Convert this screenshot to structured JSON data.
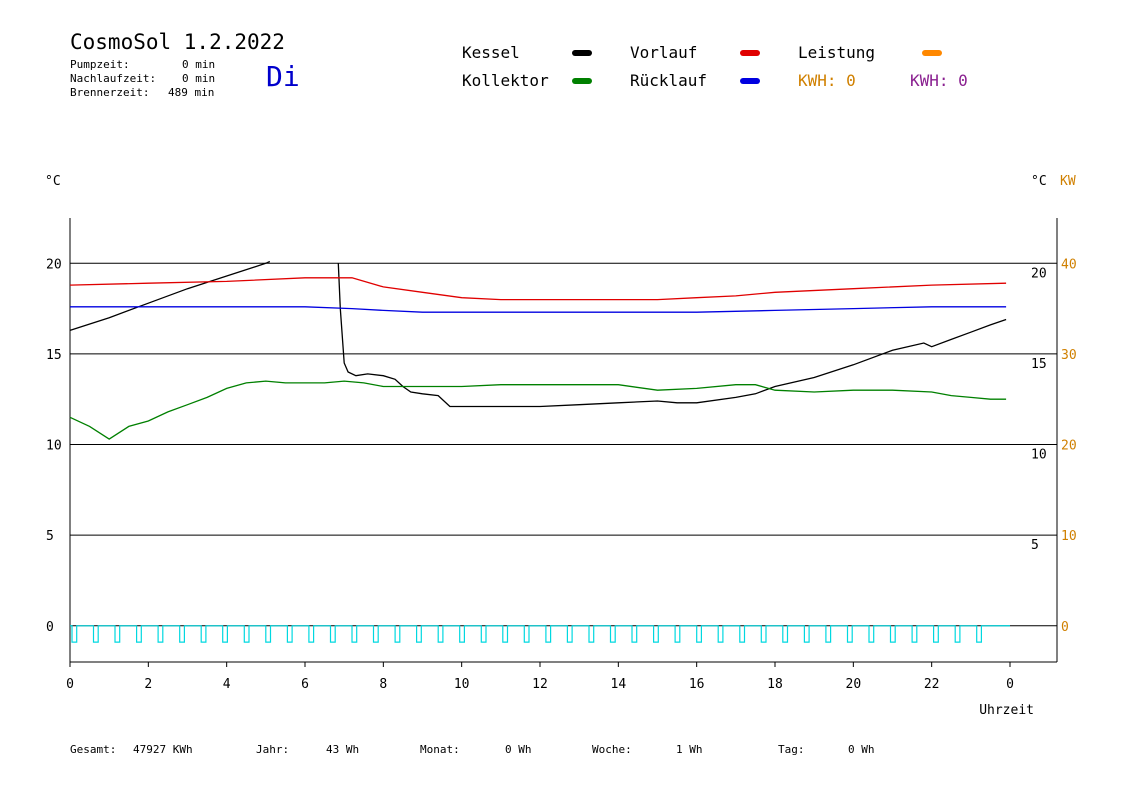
{
  "header": {
    "title": "CosmoSol 1.2.2022",
    "pump_label": "Pumpzeit:",
    "pump_value": "0 min",
    "nachlauf_label": "Nachlaufzeit:",
    "nachlauf_value": "0 min",
    "brenner_label": "Brennerzeit:",
    "brenner_value": "489 min",
    "day": "Di"
  },
  "legend": {
    "kessel": "Kessel",
    "vorlauf": "Vorlauf",
    "leistung": "Leistung",
    "kollektor": "Kollektor",
    "ruecklauf": "Rücklauf",
    "kwh1": "KWH: 0",
    "kwh2": "KWH: 0"
  },
  "colors": {
    "kessel": "#000000",
    "vorlauf": "#e00000",
    "leistung": "#ff8800",
    "kollektor": "#008000",
    "ruecklauf": "#0000e0",
    "kwh1": "#d08000",
    "kwh2": "#8a2090",
    "pump": "#00d8e0",
    "day": "#0000cc"
  },
  "footer": {
    "gesamt_label": "Gesamt:",
    "gesamt_value": "47927 KWh",
    "jahr_label": "Jahr:",
    "jahr_value": "43 Wh",
    "monat_label": "Monat:",
    "monat_value": "0 Wh",
    "woche_label": "Woche:",
    "woche_value": "1 Wh",
    "tag_label": "Tag:",
    "tag_value": "0 Wh"
  },
  "chart_data": {
    "type": "line",
    "xlabel": "Uhrzeit",
    "left_unit": "°C",
    "right_unit_1": "°C",
    "right_unit_2": "KW",
    "xlim": [
      0,
      24
    ],
    "x_ticks": [
      0,
      2,
      4,
      6,
      8,
      10,
      12,
      14,
      16,
      18,
      20,
      22,
      24
    ],
    "x_tick_labels": [
      "0",
      "2",
      "4",
      "6",
      "8",
      "10",
      "12",
      "14",
      "16",
      "18",
      "20",
      "22",
      "0"
    ],
    "left_axis": {
      "ylim": [
        -2,
        22.5
      ],
      "ticks": [
        0,
        5,
        10,
        15,
        20
      ]
    },
    "right_axis_1": {
      "ticks": [
        5,
        10,
        15,
        20
      ]
    },
    "right_axis_2": {
      "ticks": [
        0,
        10,
        20,
        30,
        40
      ]
    },
    "gridlines": [
      0,
      5,
      10,
      15,
      20
    ],
    "series": [
      {
        "name": "Kessel",
        "color": "#000000",
        "x": [
          0,
          1,
          2,
          3,
          4,
          5,
          5.1
        ],
        "y": [
          16.3,
          17.0,
          17.8,
          18.6,
          19.3,
          20.0,
          20.1
        ]
      },
      {
        "name": "Kessel",
        "color": "#000000",
        "x": [
          6.85,
          6.9,
          7.0,
          7.1,
          7.3,
          7.6,
          8.0,
          8.3,
          8.5,
          8.7,
          9.0,
          9.4,
          9.7,
          10,
          11,
          12,
          13,
          14,
          15,
          15.5,
          16,
          17,
          17.5,
          18,
          19,
          20,
          21,
          21.8,
          22,
          22.5,
          23,
          23.5,
          23.9
        ],
        "y": [
          20.0,
          17.5,
          14.5,
          14.0,
          13.8,
          13.9,
          13.8,
          13.6,
          13.2,
          12.9,
          12.8,
          12.7,
          12.1,
          12.1,
          12.1,
          12.1,
          12.2,
          12.3,
          12.4,
          12.3,
          12.3,
          12.6,
          12.8,
          13.2,
          13.7,
          14.4,
          15.2,
          15.6,
          15.4,
          15.8,
          16.2,
          16.6,
          16.9
        ]
      },
      {
        "name": "Vorlauf",
        "color": "#e00000",
        "x": [
          0,
          2,
          4,
          6,
          7.2,
          8,
          9,
          10,
          11,
          12,
          14,
          15,
          16,
          17,
          18,
          20,
          22,
          23.9
        ],
        "y": [
          18.8,
          18.9,
          19.0,
          19.2,
          19.2,
          18.7,
          18.4,
          18.1,
          18.0,
          18.0,
          18.0,
          18.0,
          18.1,
          18.2,
          18.4,
          18.6,
          18.8,
          18.9
        ]
      },
      {
        "name": "Rücklauf",
        "color": "#0000e0",
        "x": [
          0,
          6,
          7.2,
          8,
          9,
          10,
          12,
          14,
          16,
          18,
          20,
          22,
          23.9
        ],
        "y": [
          17.6,
          17.6,
          17.5,
          17.4,
          17.3,
          17.3,
          17.3,
          17.3,
          17.3,
          17.4,
          17.5,
          17.6,
          17.6
        ]
      },
      {
        "name": "Kollektor",
        "color": "#008000",
        "x": [
          0,
          0.5,
          1,
          1.5,
          2,
          2.5,
          3,
          3.5,
          4,
          4.5,
          5,
          5.5,
          6,
          6.5,
          7,
          7.5,
          8,
          9,
          10,
          11,
          12,
          13,
          14,
          15,
          16,
          17,
          17.5,
          18,
          19,
          20,
          21,
          22,
          22.5,
          23,
          23.5,
          23.9
        ],
        "y": [
          11.5,
          11.0,
          10.3,
          11.0,
          11.3,
          11.8,
          12.2,
          12.6,
          13.1,
          13.4,
          13.5,
          13.4,
          13.4,
          13.4,
          13.5,
          13.4,
          13.2,
          13.2,
          13.2,
          13.3,
          13.3,
          13.3,
          13.3,
          13.0,
          13.1,
          13.3,
          13.3,
          13.0,
          12.9,
          13.0,
          13.0,
          12.9,
          12.7,
          12.6,
          12.5,
          12.5
        ]
      },
      {
        "name": "Pumpe",
        "color": "#00d8e0",
        "baseline": 0,
        "pulse": -0.9
      }
    ]
  }
}
